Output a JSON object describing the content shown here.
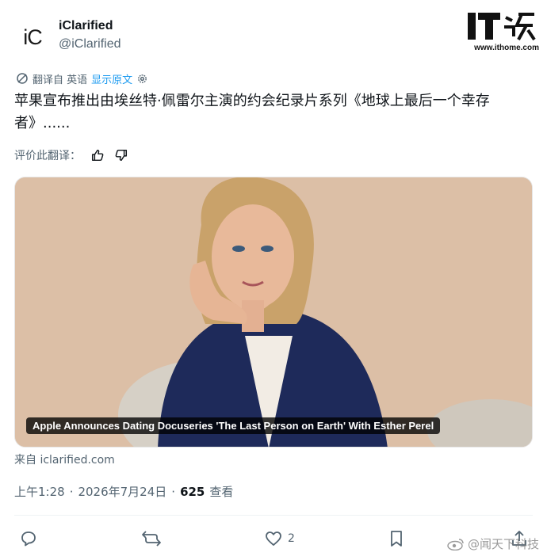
{
  "account": {
    "avatar_text": "iC",
    "name": "iClarified",
    "handle": "@iClarified"
  },
  "brand": {
    "logo_text": "IT之家",
    "url": "www.ithome.com"
  },
  "translation": {
    "label": "翻译自 英语",
    "show_original": "显示原文"
  },
  "post": {
    "text": "苹果宣布推出由埃丝特·佩雷尔主演的约会纪录片系列《地球上最后一个幸存者》......"
  },
  "rate": {
    "label": "评价此翻译："
  },
  "media": {
    "caption": "Apple Announces Dating Docuseries 'The Last Person on Earth' With Esther Perel"
  },
  "source": {
    "text": "来自 iclarified.com"
  },
  "meta": {
    "time": "上午1:28",
    "date": "2026年7月24日",
    "views_count": "625",
    "views_label": "查看"
  },
  "actions": {
    "likes": "2"
  },
  "watermark": {
    "text": "@闻天下科技"
  },
  "colors": {
    "link": "#1d9bf0",
    "muted": "#536471",
    "text": "#0f1419"
  }
}
